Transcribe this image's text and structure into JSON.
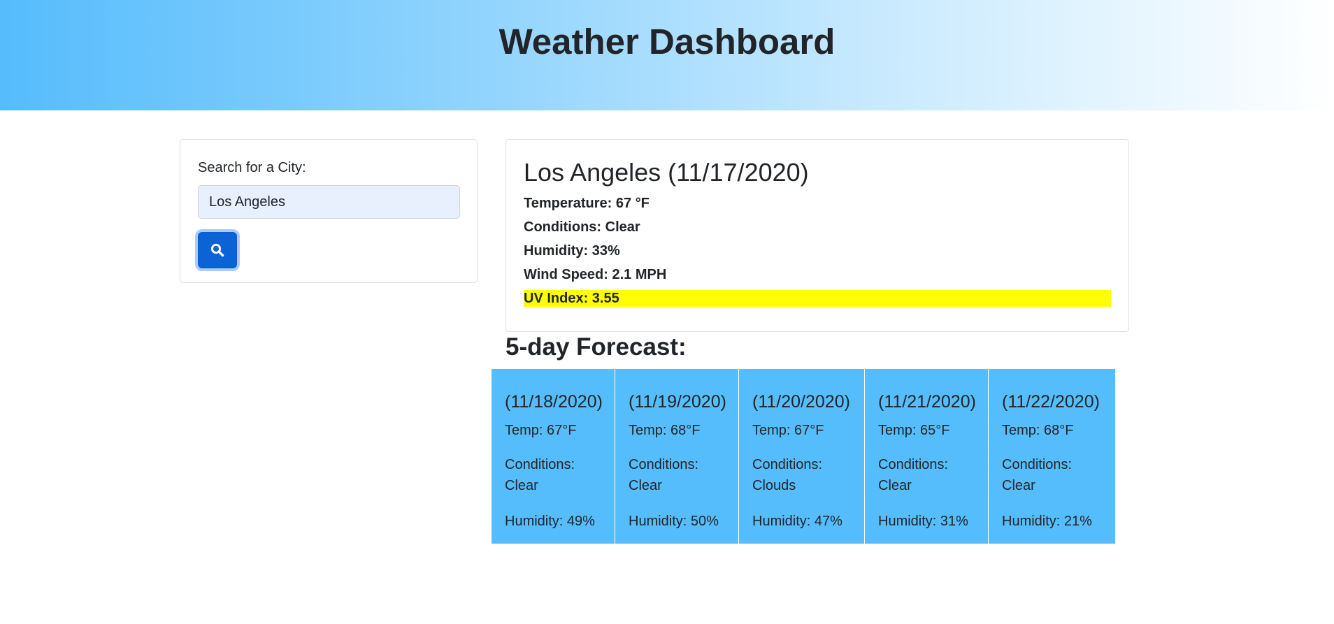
{
  "header": {
    "title": "Weather Dashboard"
  },
  "search": {
    "label": "Search for a City:",
    "value": "Los Angeles",
    "button_icon": "search-icon"
  },
  "current": {
    "title": "Los Angeles (11/17/2020)",
    "temperature": "Temperature: 67 °F",
    "conditions": "Conditions: Clear",
    "humidity": "Humidity: 33%",
    "wind": "Wind Speed: 2.1 MPH",
    "uv": "UV Index: 3.55",
    "uv_color": "#ffff00"
  },
  "forecast": {
    "heading": "5-day Forecast:",
    "card_color": "#56bdfc",
    "days": [
      {
        "date": "(11/18/2020)",
        "temp": "Temp: 67°F",
        "conditions_label": "Conditions:",
        "conditions_value": "Clear",
        "humidity": "Humidity: 49%"
      },
      {
        "date": "(11/19/2020)",
        "temp": "Temp: 68°F",
        "conditions_label": "Conditions:",
        "conditions_value": "Clear",
        "humidity": "Humidity: 50%"
      },
      {
        "date": "(11/20/2020)",
        "temp": "Temp: 67°F",
        "conditions_label": "Conditions:",
        "conditions_value": "Clouds",
        "humidity": "Humidity: 47%"
      },
      {
        "date": "(11/21/2020)",
        "temp": "Temp: 65°F",
        "conditions_label": "Conditions:",
        "conditions_value": "Clear",
        "humidity": "Humidity: 31%"
      },
      {
        "date": "(11/22/2020)",
        "temp": "Temp: 68°F",
        "conditions_label": "Conditions:",
        "conditions_value": "Clear",
        "humidity": "Humidity: 21%"
      }
    ]
  }
}
